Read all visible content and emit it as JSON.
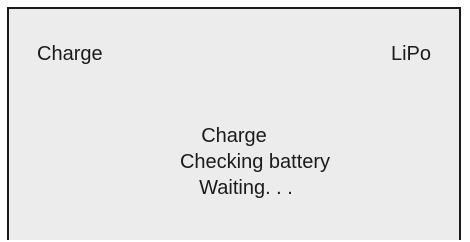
{
  "screen": {
    "mode_label": "Charge",
    "battery_type": "LiPo",
    "status_title": "Charge",
    "status_message": "Checking battery",
    "status_detail": "Waiting. . ."
  },
  "colors": {
    "background": "#ececec",
    "border": "#1a1a1a",
    "text": "#1a1a1a"
  }
}
